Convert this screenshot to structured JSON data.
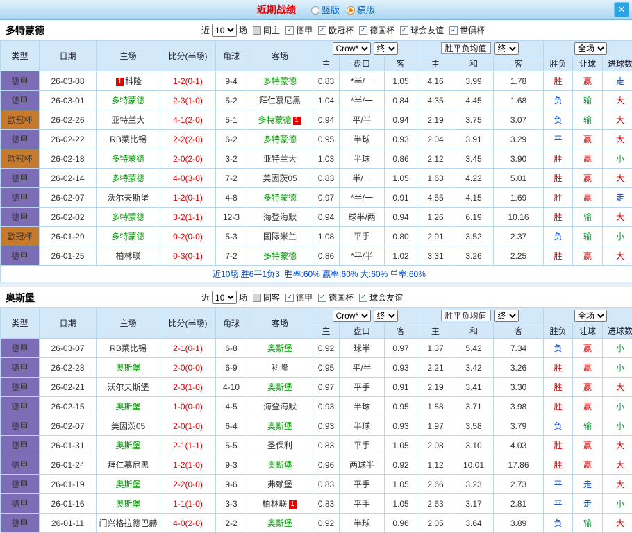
{
  "topbar": {
    "title": "近期战绩",
    "radios": [
      {
        "label": "竖版",
        "checked": false
      },
      {
        "label": "横版",
        "checked": true
      }
    ],
    "close_icon": "✕"
  },
  "filter_labels": {
    "near": "近",
    "games": "场"
  },
  "table_header": {
    "col_type": "类型",
    "col_date": "日期",
    "col_home": "主场",
    "col_score": "比分(半场)",
    "col_corner": "角球",
    "col_away": "客场",
    "odds_source": "Crow*",
    "final_label": "终",
    "mean_label": "胜平负均值",
    "scope_label": "全场",
    "sub": [
      "主",
      "盘口",
      "客",
      "主",
      "和",
      "客",
      "胜负",
      "让球",
      "进球数"
    ]
  },
  "colors": {
    "league": {
      "德甲": "#7d6cb6",
      "欧冠杯": "#c77a2e"
    },
    "results": {
      "胜": "#e60000",
      "赢": "#e60000",
      "大": "#e60000",
      "平": "#0046cc",
      "走": "#0046cc",
      "负": "#0046cc",
      "输": "#009933",
      "小": "#009933"
    },
    "focus_team": "#009900",
    "score": "#e60000",
    "header_bg": "#d3e9f9"
  },
  "sections": [
    {
      "team": "多特蒙德",
      "filter": {
        "count": "10",
        "same_label": "同主",
        "same_checked": false,
        "leagues": [
          {
            "label": "德甲",
            "checked": true
          },
          {
            "label": "欧冠杯",
            "checked": true
          },
          {
            "label": "德国杯",
            "checked": true
          },
          {
            "label": "球会友谊",
            "checked": true
          },
          {
            "label": "世俱杯",
            "checked": true
          }
        ]
      },
      "rows": [
        {
          "league": "德甲",
          "date": "26-03-08",
          "home": {
            "name": "科隆",
            "focus": false,
            "badge": "1",
            "badge_side": "left"
          },
          "score": "1-2(0-1)",
          "corner": "9-4",
          "away": {
            "name": "多特蒙德",
            "focus": true
          },
          "odds": [
            "0.83",
            "*半/一",
            "1.05"
          ],
          "mean": [
            "4.16",
            "3.99",
            "1.78"
          ],
          "results": [
            "胜",
            "赢",
            "走"
          ]
        },
        {
          "league": "德甲",
          "date": "26-03-01",
          "home": {
            "name": "多特蒙德",
            "focus": true
          },
          "score": "2-3(1-0)",
          "corner": "5-2",
          "away": {
            "name": "拜仁慕尼黑",
            "focus": false
          },
          "odds": [
            "1.04",
            "*半/一",
            "0.84"
          ],
          "mean": [
            "4.35",
            "4.45",
            "1.68"
          ],
          "results": [
            "负",
            "输",
            "大"
          ]
        },
        {
          "league": "欧冠杯",
          "date": "26-02-26",
          "home": {
            "name": "亚特兰大",
            "focus": false
          },
          "score": "4-1(2-0)",
          "corner": "5-1",
          "away": {
            "name": "多特蒙德",
            "focus": true,
            "badge": "1",
            "badge_side": "right"
          },
          "odds": [
            "0.94",
            "平/半",
            "0.94"
          ],
          "mean": [
            "2.19",
            "3.75",
            "3.07"
          ],
          "results": [
            "负",
            "输",
            "大"
          ]
        },
        {
          "league": "德甲",
          "date": "26-02-22",
          "home": {
            "name": "RB莱比锡",
            "focus": false
          },
          "score": "2-2(2-0)",
          "corner": "6-2",
          "away": {
            "name": "多特蒙德",
            "focus": true
          },
          "odds": [
            "0.95",
            "半球",
            "0.93"
          ],
          "mean": [
            "2.04",
            "3.91",
            "3.29"
          ],
          "results": [
            "平",
            "赢",
            "大"
          ]
        },
        {
          "league": "欧冠杯",
          "date": "26-02-18",
          "home": {
            "name": "多特蒙德",
            "focus": true
          },
          "score": "2-0(2-0)",
          "corner": "3-2",
          "away": {
            "name": "亚特兰大",
            "focus": false
          },
          "odds": [
            "1.03",
            "半球",
            "0.86"
          ],
          "mean": [
            "2.12",
            "3.45",
            "3.90"
          ],
          "results": [
            "胜",
            "赢",
            "小"
          ]
        },
        {
          "league": "德甲",
          "date": "26-02-14",
          "home": {
            "name": "多特蒙德",
            "focus": true
          },
          "score": "4-0(3-0)",
          "corner": "7-2",
          "away": {
            "name": "美因茨05",
            "focus": false
          },
          "odds": [
            "0.83",
            "半/一",
            "1.05"
          ],
          "mean": [
            "1.63",
            "4.22",
            "5.01"
          ],
          "results": [
            "胜",
            "赢",
            "大"
          ]
        },
        {
          "league": "德甲",
          "date": "26-02-07",
          "home": {
            "name": "沃尔夫斯堡",
            "focus": false
          },
          "score": "1-2(0-1)",
          "corner": "4-8",
          "away": {
            "name": "多特蒙德",
            "focus": true
          },
          "odds": [
            "0.97",
            "*半/一",
            "0.91"
          ],
          "mean": [
            "4.55",
            "4.15",
            "1.69"
          ],
          "results": [
            "胜",
            "赢",
            "走"
          ]
        },
        {
          "league": "德甲",
          "date": "26-02-02",
          "home": {
            "name": "多特蒙德",
            "focus": true
          },
          "score": "3-2(1-1)",
          "corner": "12-3",
          "away": {
            "name": "海登海默",
            "focus": false
          },
          "odds": [
            "0.94",
            "球半/两",
            "0.94"
          ],
          "mean": [
            "1.26",
            "6.19",
            "10.16"
          ],
          "results": [
            "胜",
            "输",
            "大"
          ]
        },
        {
          "league": "欧冠杯",
          "date": "26-01-29",
          "home": {
            "name": "多特蒙德",
            "focus": true
          },
          "score": "0-2(0-0)",
          "corner": "5-3",
          "away": {
            "name": "国际米兰",
            "focus": false
          },
          "odds": [
            "1.08",
            "平手",
            "0.80"
          ],
          "mean": [
            "2.91",
            "3.52",
            "2.37"
          ],
          "results": [
            "负",
            "输",
            "小"
          ]
        },
        {
          "league": "德甲",
          "date": "26-01-25",
          "home": {
            "name": "柏林联",
            "focus": false
          },
          "score": "0-3(0-1)",
          "corner": "7-2",
          "away": {
            "name": "多特蒙德",
            "focus": true
          },
          "odds": [
            "0.86",
            "*平/半",
            "1.02"
          ],
          "mean": [
            "3.31",
            "3.26",
            "2.25"
          ],
          "results": [
            "胜",
            "赢",
            "大"
          ]
        }
      ],
      "summary": "近10场,胜6平1负3, 胜率:60% 赢率:60% 大:60% 单率:60%"
    },
    {
      "team": "奥斯堡",
      "filter": {
        "count": "10",
        "same_label": "同客",
        "same_checked": false,
        "leagues": [
          {
            "label": "德甲",
            "checked": true
          },
          {
            "label": "德国杯",
            "checked": true
          },
          {
            "label": "球会友谊",
            "checked": true
          }
        ]
      },
      "rows": [
        {
          "league": "德甲",
          "date": "26-03-07",
          "home": {
            "name": "RB莱比锡",
            "focus": false
          },
          "score": "2-1(0-1)",
          "corner": "6-8",
          "away": {
            "name": "奥斯堡",
            "focus": true
          },
          "odds": [
            "0.92",
            "球半",
            "0.97"
          ],
          "mean": [
            "1.37",
            "5.42",
            "7.34"
          ],
          "results": [
            "负",
            "赢",
            "小"
          ]
        },
        {
          "league": "德甲",
          "date": "26-02-28",
          "home": {
            "name": "奥斯堡",
            "focus": true
          },
          "score": "2-0(0-0)",
          "corner": "6-9",
          "away": {
            "name": "科隆",
            "focus": false
          },
          "odds": [
            "0.95",
            "平/半",
            "0.93"
          ],
          "mean": [
            "2.21",
            "3.42",
            "3.26"
          ],
          "results": [
            "胜",
            "赢",
            "小"
          ]
        },
        {
          "league": "德甲",
          "date": "26-02-21",
          "home": {
            "name": "沃尔夫斯堡",
            "focus": false
          },
          "score": "2-3(1-0)",
          "corner": "4-10",
          "away": {
            "name": "奥斯堡",
            "focus": true
          },
          "odds": [
            "0.97",
            "平手",
            "0.91"
          ],
          "mean": [
            "2.19",
            "3.41",
            "3.30"
          ],
          "results": [
            "胜",
            "赢",
            "大"
          ]
        },
        {
          "league": "德甲",
          "date": "26-02-15",
          "home": {
            "name": "奥斯堡",
            "focus": true
          },
          "score": "1-0(0-0)",
          "corner": "4-5",
          "away": {
            "name": "海登海默",
            "focus": false
          },
          "odds": [
            "0.93",
            "半球",
            "0.95"
          ],
          "mean": [
            "1.88",
            "3.71",
            "3.98"
          ],
          "results": [
            "胜",
            "赢",
            "小"
          ]
        },
        {
          "league": "德甲",
          "date": "26-02-07",
          "home": {
            "name": "美因茨05",
            "focus": false
          },
          "score": "2-0(1-0)",
          "corner": "6-4",
          "away": {
            "name": "奥斯堡",
            "focus": true
          },
          "odds": [
            "0.93",
            "半球",
            "0.93"
          ],
          "mean": [
            "1.97",
            "3.58",
            "3.79"
          ],
          "results": [
            "负",
            "输",
            "小"
          ]
        },
        {
          "league": "德甲",
          "date": "26-01-31",
          "home": {
            "name": "奥斯堡",
            "focus": true
          },
          "score": "2-1(1-1)",
          "corner": "5-5",
          "away": {
            "name": "圣保利",
            "focus": false
          },
          "odds": [
            "0.83",
            "平手",
            "1.05"
          ],
          "mean": [
            "2.08",
            "3.10",
            "4.03"
          ],
          "results": [
            "胜",
            "赢",
            "大"
          ]
        },
        {
          "league": "德甲",
          "date": "26-01-24",
          "home": {
            "name": "拜仁慕尼黑",
            "focus": false
          },
          "score": "1-2(1-0)",
          "corner": "9-3",
          "away": {
            "name": "奥斯堡",
            "focus": true
          },
          "odds": [
            "0.96",
            "两球半",
            "0.92"
          ],
          "mean": [
            "1.12",
            "10.01",
            "17.86"
          ],
          "results": [
            "胜",
            "赢",
            "大"
          ]
        },
        {
          "league": "德甲",
          "date": "26-01-19",
          "home": {
            "name": "奥斯堡",
            "focus": true
          },
          "score": "2-2(0-0)",
          "corner": "9-6",
          "away": {
            "name": "弗赖堡",
            "focus": false
          },
          "odds": [
            "0.83",
            "平手",
            "1.05"
          ],
          "mean": [
            "2.66",
            "3.23",
            "2.73"
          ],
          "results": [
            "平",
            "走",
            "大"
          ]
        },
        {
          "league": "德甲",
          "date": "26-01-16",
          "home": {
            "name": "奥斯堡",
            "focus": true
          },
          "score": "1-1(1-0)",
          "corner": "3-3",
          "away": {
            "name": "柏林联",
            "focus": false,
            "badge": "1",
            "badge_side": "right"
          },
          "odds": [
            "0.83",
            "平手",
            "1.05"
          ],
          "mean": [
            "2.63",
            "3.17",
            "2.81"
          ],
          "results": [
            "平",
            "走",
            "小"
          ]
        },
        {
          "league": "德甲",
          "date": "26-01-11",
          "home": {
            "name": "门兴格拉德巴赫",
            "focus": false
          },
          "score": "4-0(2-0)",
          "corner": "2-2",
          "away": {
            "name": "奥斯堡",
            "focus": true
          },
          "odds": [
            "0.92",
            "半球",
            "0.96"
          ],
          "mean": [
            "2.05",
            "3.64",
            "3.89"
          ],
          "results": [
            "负",
            "输",
            "大"
          ]
        }
      ],
      "summary": null
    }
  ]
}
